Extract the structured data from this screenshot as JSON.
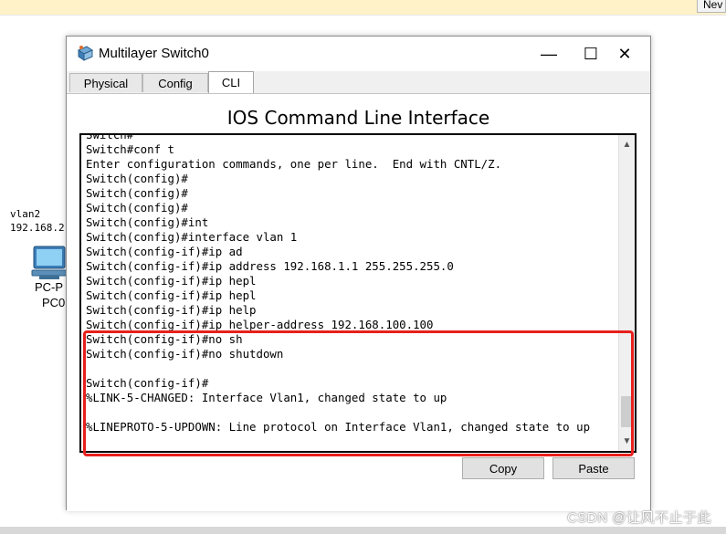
{
  "app": {
    "new_button_label": "Nev"
  },
  "workspace": {
    "vlan_label": "vlan2",
    "ip_label": "192.168.2.",
    "pc_label_1": "PC-P",
    "pc_label_2": "PC0"
  },
  "window": {
    "title": "Multilayer Switch0",
    "controls": {
      "minimize": "—",
      "maximize": "☐",
      "close": "✕"
    },
    "tabs": [
      {
        "label": "Physical",
        "active": false
      },
      {
        "label": "Config",
        "active": false
      },
      {
        "label": "CLI",
        "active": true
      }
    ],
    "heading": "IOS Command Line Interface",
    "terminal_lines": [
      "Switch#",
      "Switch#conf t",
      "Enter configuration commands, one per line.  End with CNTL/Z.",
      "Switch(config)#",
      "Switch(config)#",
      "Switch(config)#",
      "Switch(config)#int",
      "Switch(config)#interface vlan 1",
      "Switch(config-if)#ip ad",
      "Switch(config-if)#ip address 192.168.1.1 255.255.255.0",
      "Switch(config-if)#ip hepl",
      "Switch(config-if)#ip hepl",
      "Switch(config-if)#ip help",
      "Switch(config-if)#ip helper-address 192.168.100.100",
      "Switch(config-if)#no sh",
      "Switch(config-if)#no shutdown",
      "",
      "Switch(config-if)#",
      "%LINK-5-CHANGED: Interface Vlan1, changed state to up",
      "",
      "%LINEPROTO-5-UPDOWN: Line protocol on Interface Vlan1, changed state to up"
    ],
    "buttons": {
      "copy": "Copy",
      "paste": "Paste"
    }
  },
  "watermark": "CSDN @让风不止于此",
  "colors": {
    "highlight": "#e8201c",
    "topbar": "#fff2c8"
  },
  "icons": [
    "switch-icon",
    "pc-icon",
    "scroll-up-icon",
    "scroll-down-icon"
  ]
}
